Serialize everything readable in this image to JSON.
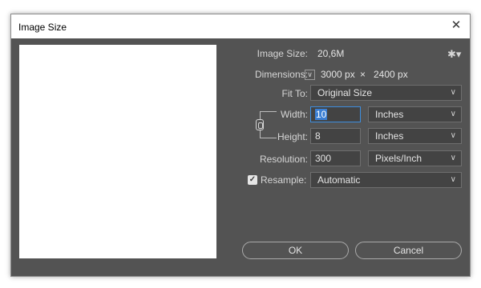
{
  "window": {
    "title": "Image Size",
    "close_icon": "✕"
  },
  "image_size": {
    "label": "Image Size:",
    "value": "20,6M"
  },
  "dimensions": {
    "label": "Dimensions:",
    "width": "3000 px",
    "separator": "×",
    "height": "2400 px"
  },
  "fit_to": {
    "label": "Fit To:",
    "value": "Original Size"
  },
  "width": {
    "label": "Width:",
    "value": "10",
    "unit": "Inches"
  },
  "height": {
    "label": "Height:",
    "value": "8",
    "unit": "Inches"
  },
  "resolution": {
    "label": "Resolution:",
    "value": "300",
    "unit": "Pixels/Inch"
  },
  "resample": {
    "label": "Resample:",
    "checked": true,
    "value": "Automatic"
  },
  "buttons": {
    "ok": "OK",
    "cancel": "Cancel"
  },
  "colors": {
    "dialog_bg": "#535353",
    "field_bg": "#434343",
    "selection": "#3b7fd4"
  },
  "icons": {
    "settings": "gear-icon",
    "dimensions_toggle": "chevron-down-icon",
    "constrain": "link-icon",
    "check": "checkmark-icon"
  }
}
